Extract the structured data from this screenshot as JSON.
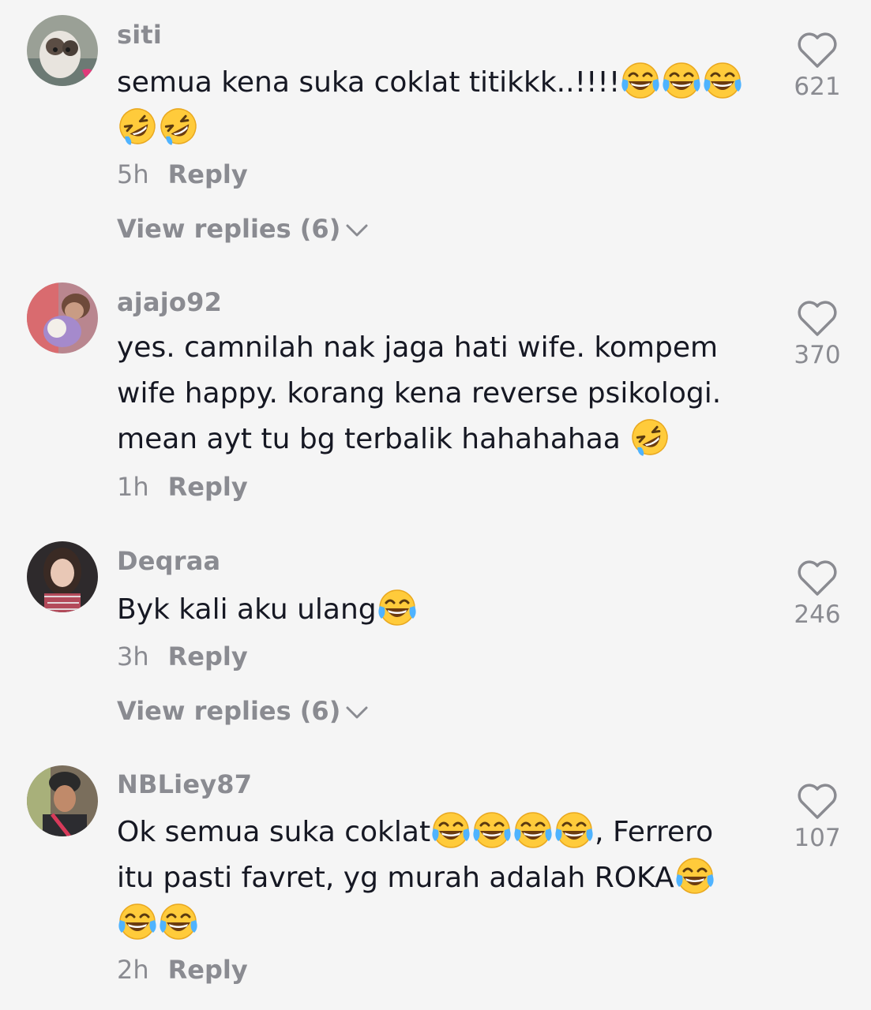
{
  "comments": [
    {
      "username": "siti",
      "text_lines": [
        "semua kena suka coklat titikkk..!!!!",
        ""
      ],
      "time": "5h",
      "reply_label": "Reply",
      "view_replies_label": "View replies (6)",
      "likes": "621"
    },
    {
      "username": "ajajo92",
      "text_lines": [
        "yes. camnilah nak jaga hati wife. kompem",
        "wife happy. korang kena reverse psikologi.",
        "mean ayt tu bg terbalik hahahahaa "
      ],
      "time": "1h",
      "reply_label": "Reply",
      "likes": "370"
    },
    {
      "username": "Deqraa",
      "text_lines": [
        "Byk kali aku ulang"
      ],
      "time": "3h",
      "reply_label": "Reply",
      "view_replies_label": "View replies (6)",
      "likes": "246"
    },
    {
      "username": "NBLiey87",
      "text_lines": [
        "Ok semua suka coklat",
        ", Ferrero",
        "itu pasti favret, yg murah adalah ROKA",
        ""
      ],
      "time": "2h",
      "reply_label": "Reply",
      "likes": "107"
    }
  ],
  "icons": {
    "heart": "heart-outline-icon",
    "chevron": "chevron-down-icon",
    "emoji_joy": "face-with-tears-of-joy-emoji",
    "emoji_rofl": "rolling-on-floor-laughing-emoji"
  },
  "colors": {
    "background": "#f5f5f5",
    "primary_text": "#161823",
    "secondary_text": "#8a8b91",
    "emoji_yellow": "#ffcc33"
  }
}
